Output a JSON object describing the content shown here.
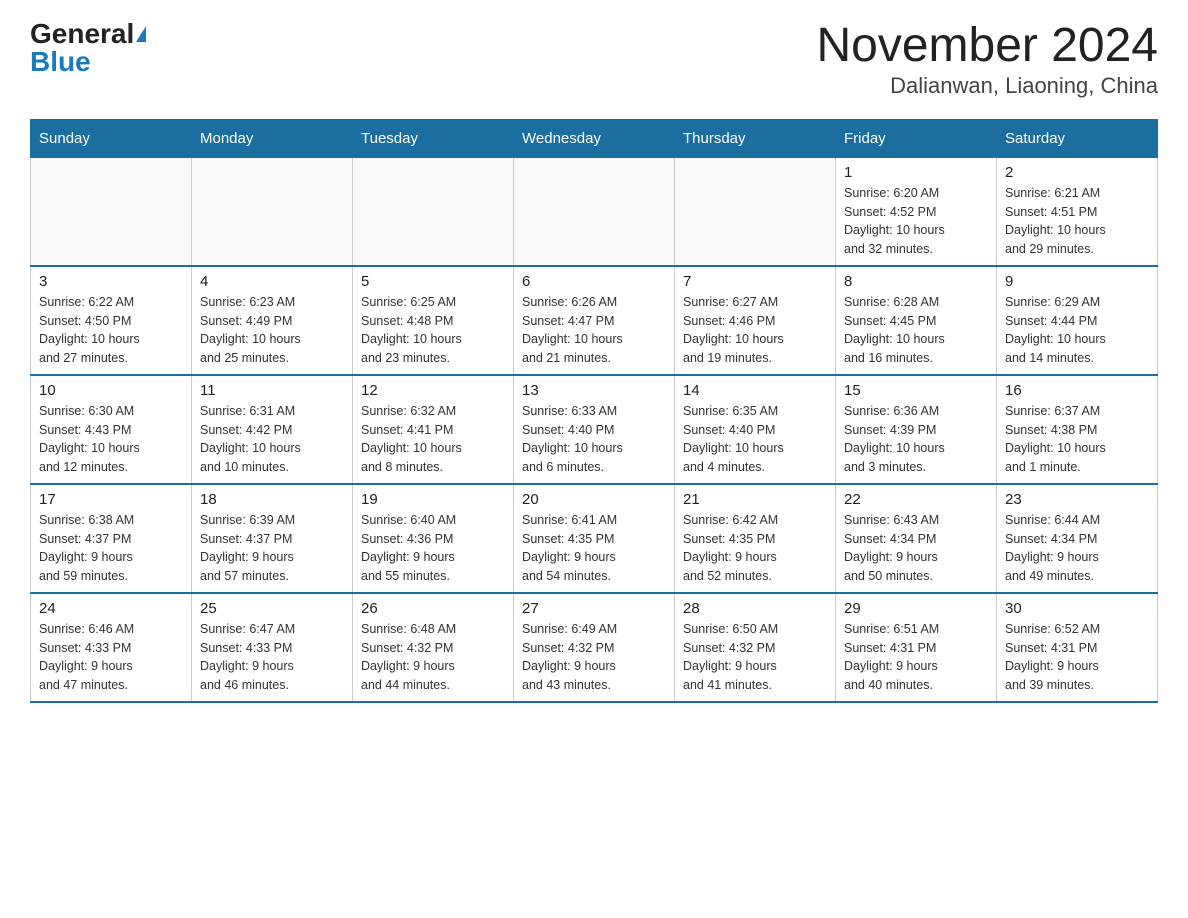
{
  "header": {
    "logo_general": "General",
    "logo_blue": "Blue",
    "title": "November 2024",
    "subtitle": "Dalianwan, Liaoning, China"
  },
  "weekdays": [
    "Sunday",
    "Monday",
    "Tuesday",
    "Wednesday",
    "Thursday",
    "Friday",
    "Saturday"
  ],
  "weeks": [
    [
      {
        "day": "",
        "info": ""
      },
      {
        "day": "",
        "info": ""
      },
      {
        "day": "",
        "info": ""
      },
      {
        "day": "",
        "info": ""
      },
      {
        "day": "",
        "info": ""
      },
      {
        "day": "1",
        "info": "Sunrise: 6:20 AM\nSunset: 4:52 PM\nDaylight: 10 hours\nand 32 minutes."
      },
      {
        "day": "2",
        "info": "Sunrise: 6:21 AM\nSunset: 4:51 PM\nDaylight: 10 hours\nand 29 minutes."
      }
    ],
    [
      {
        "day": "3",
        "info": "Sunrise: 6:22 AM\nSunset: 4:50 PM\nDaylight: 10 hours\nand 27 minutes."
      },
      {
        "day": "4",
        "info": "Sunrise: 6:23 AM\nSunset: 4:49 PM\nDaylight: 10 hours\nand 25 minutes."
      },
      {
        "day": "5",
        "info": "Sunrise: 6:25 AM\nSunset: 4:48 PM\nDaylight: 10 hours\nand 23 minutes."
      },
      {
        "day": "6",
        "info": "Sunrise: 6:26 AM\nSunset: 4:47 PM\nDaylight: 10 hours\nand 21 minutes."
      },
      {
        "day": "7",
        "info": "Sunrise: 6:27 AM\nSunset: 4:46 PM\nDaylight: 10 hours\nand 19 minutes."
      },
      {
        "day": "8",
        "info": "Sunrise: 6:28 AM\nSunset: 4:45 PM\nDaylight: 10 hours\nand 16 minutes."
      },
      {
        "day": "9",
        "info": "Sunrise: 6:29 AM\nSunset: 4:44 PM\nDaylight: 10 hours\nand 14 minutes."
      }
    ],
    [
      {
        "day": "10",
        "info": "Sunrise: 6:30 AM\nSunset: 4:43 PM\nDaylight: 10 hours\nand 12 minutes."
      },
      {
        "day": "11",
        "info": "Sunrise: 6:31 AM\nSunset: 4:42 PM\nDaylight: 10 hours\nand 10 minutes."
      },
      {
        "day": "12",
        "info": "Sunrise: 6:32 AM\nSunset: 4:41 PM\nDaylight: 10 hours\nand 8 minutes."
      },
      {
        "day": "13",
        "info": "Sunrise: 6:33 AM\nSunset: 4:40 PM\nDaylight: 10 hours\nand 6 minutes."
      },
      {
        "day": "14",
        "info": "Sunrise: 6:35 AM\nSunset: 4:40 PM\nDaylight: 10 hours\nand 4 minutes."
      },
      {
        "day": "15",
        "info": "Sunrise: 6:36 AM\nSunset: 4:39 PM\nDaylight: 10 hours\nand 3 minutes."
      },
      {
        "day": "16",
        "info": "Sunrise: 6:37 AM\nSunset: 4:38 PM\nDaylight: 10 hours\nand 1 minute."
      }
    ],
    [
      {
        "day": "17",
        "info": "Sunrise: 6:38 AM\nSunset: 4:37 PM\nDaylight: 9 hours\nand 59 minutes."
      },
      {
        "day": "18",
        "info": "Sunrise: 6:39 AM\nSunset: 4:37 PM\nDaylight: 9 hours\nand 57 minutes."
      },
      {
        "day": "19",
        "info": "Sunrise: 6:40 AM\nSunset: 4:36 PM\nDaylight: 9 hours\nand 55 minutes."
      },
      {
        "day": "20",
        "info": "Sunrise: 6:41 AM\nSunset: 4:35 PM\nDaylight: 9 hours\nand 54 minutes."
      },
      {
        "day": "21",
        "info": "Sunrise: 6:42 AM\nSunset: 4:35 PM\nDaylight: 9 hours\nand 52 minutes."
      },
      {
        "day": "22",
        "info": "Sunrise: 6:43 AM\nSunset: 4:34 PM\nDaylight: 9 hours\nand 50 minutes."
      },
      {
        "day": "23",
        "info": "Sunrise: 6:44 AM\nSunset: 4:34 PM\nDaylight: 9 hours\nand 49 minutes."
      }
    ],
    [
      {
        "day": "24",
        "info": "Sunrise: 6:46 AM\nSunset: 4:33 PM\nDaylight: 9 hours\nand 47 minutes."
      },
      {
        "day": "25",
        "info": "Sunrise: 6:47 AM\nSunset: 4:33 PM\nDaylight: 9 hours\nand 46 minutes."
      },
      {
        "day": "26",
        "info": "Sunrise: 6:48 AM\nSunset: 4:32 PM\nDaylight: 9 hours\nand 44 minutes."
      },
      {
        "day": "27",
        "info": "Sunrise: 6:49 AM\nSunset: 4:32 PM\nDaylight: 9 hours\nand 43 minutes."
      },
      {
        "day": "28",
        "info": "Sunrise: 6:50 AM\nSunset: 4:32 PM\nDaylight: 9 hours\nand 41 minutes."
      },
      {
        "day": "29",
        "info": "Sunrise: 6:51 AM\nSunset: 4:31 PM\nDaylight: 9 hours\nand 40 minutes."
      },
      {
        "day": "30",
        "info": "Sunrise: 6:52 AM\nSunset: 4:31 PM\nDaylight: 9 hours\nand 39 minutes."
      }
    ]
  ]
}
